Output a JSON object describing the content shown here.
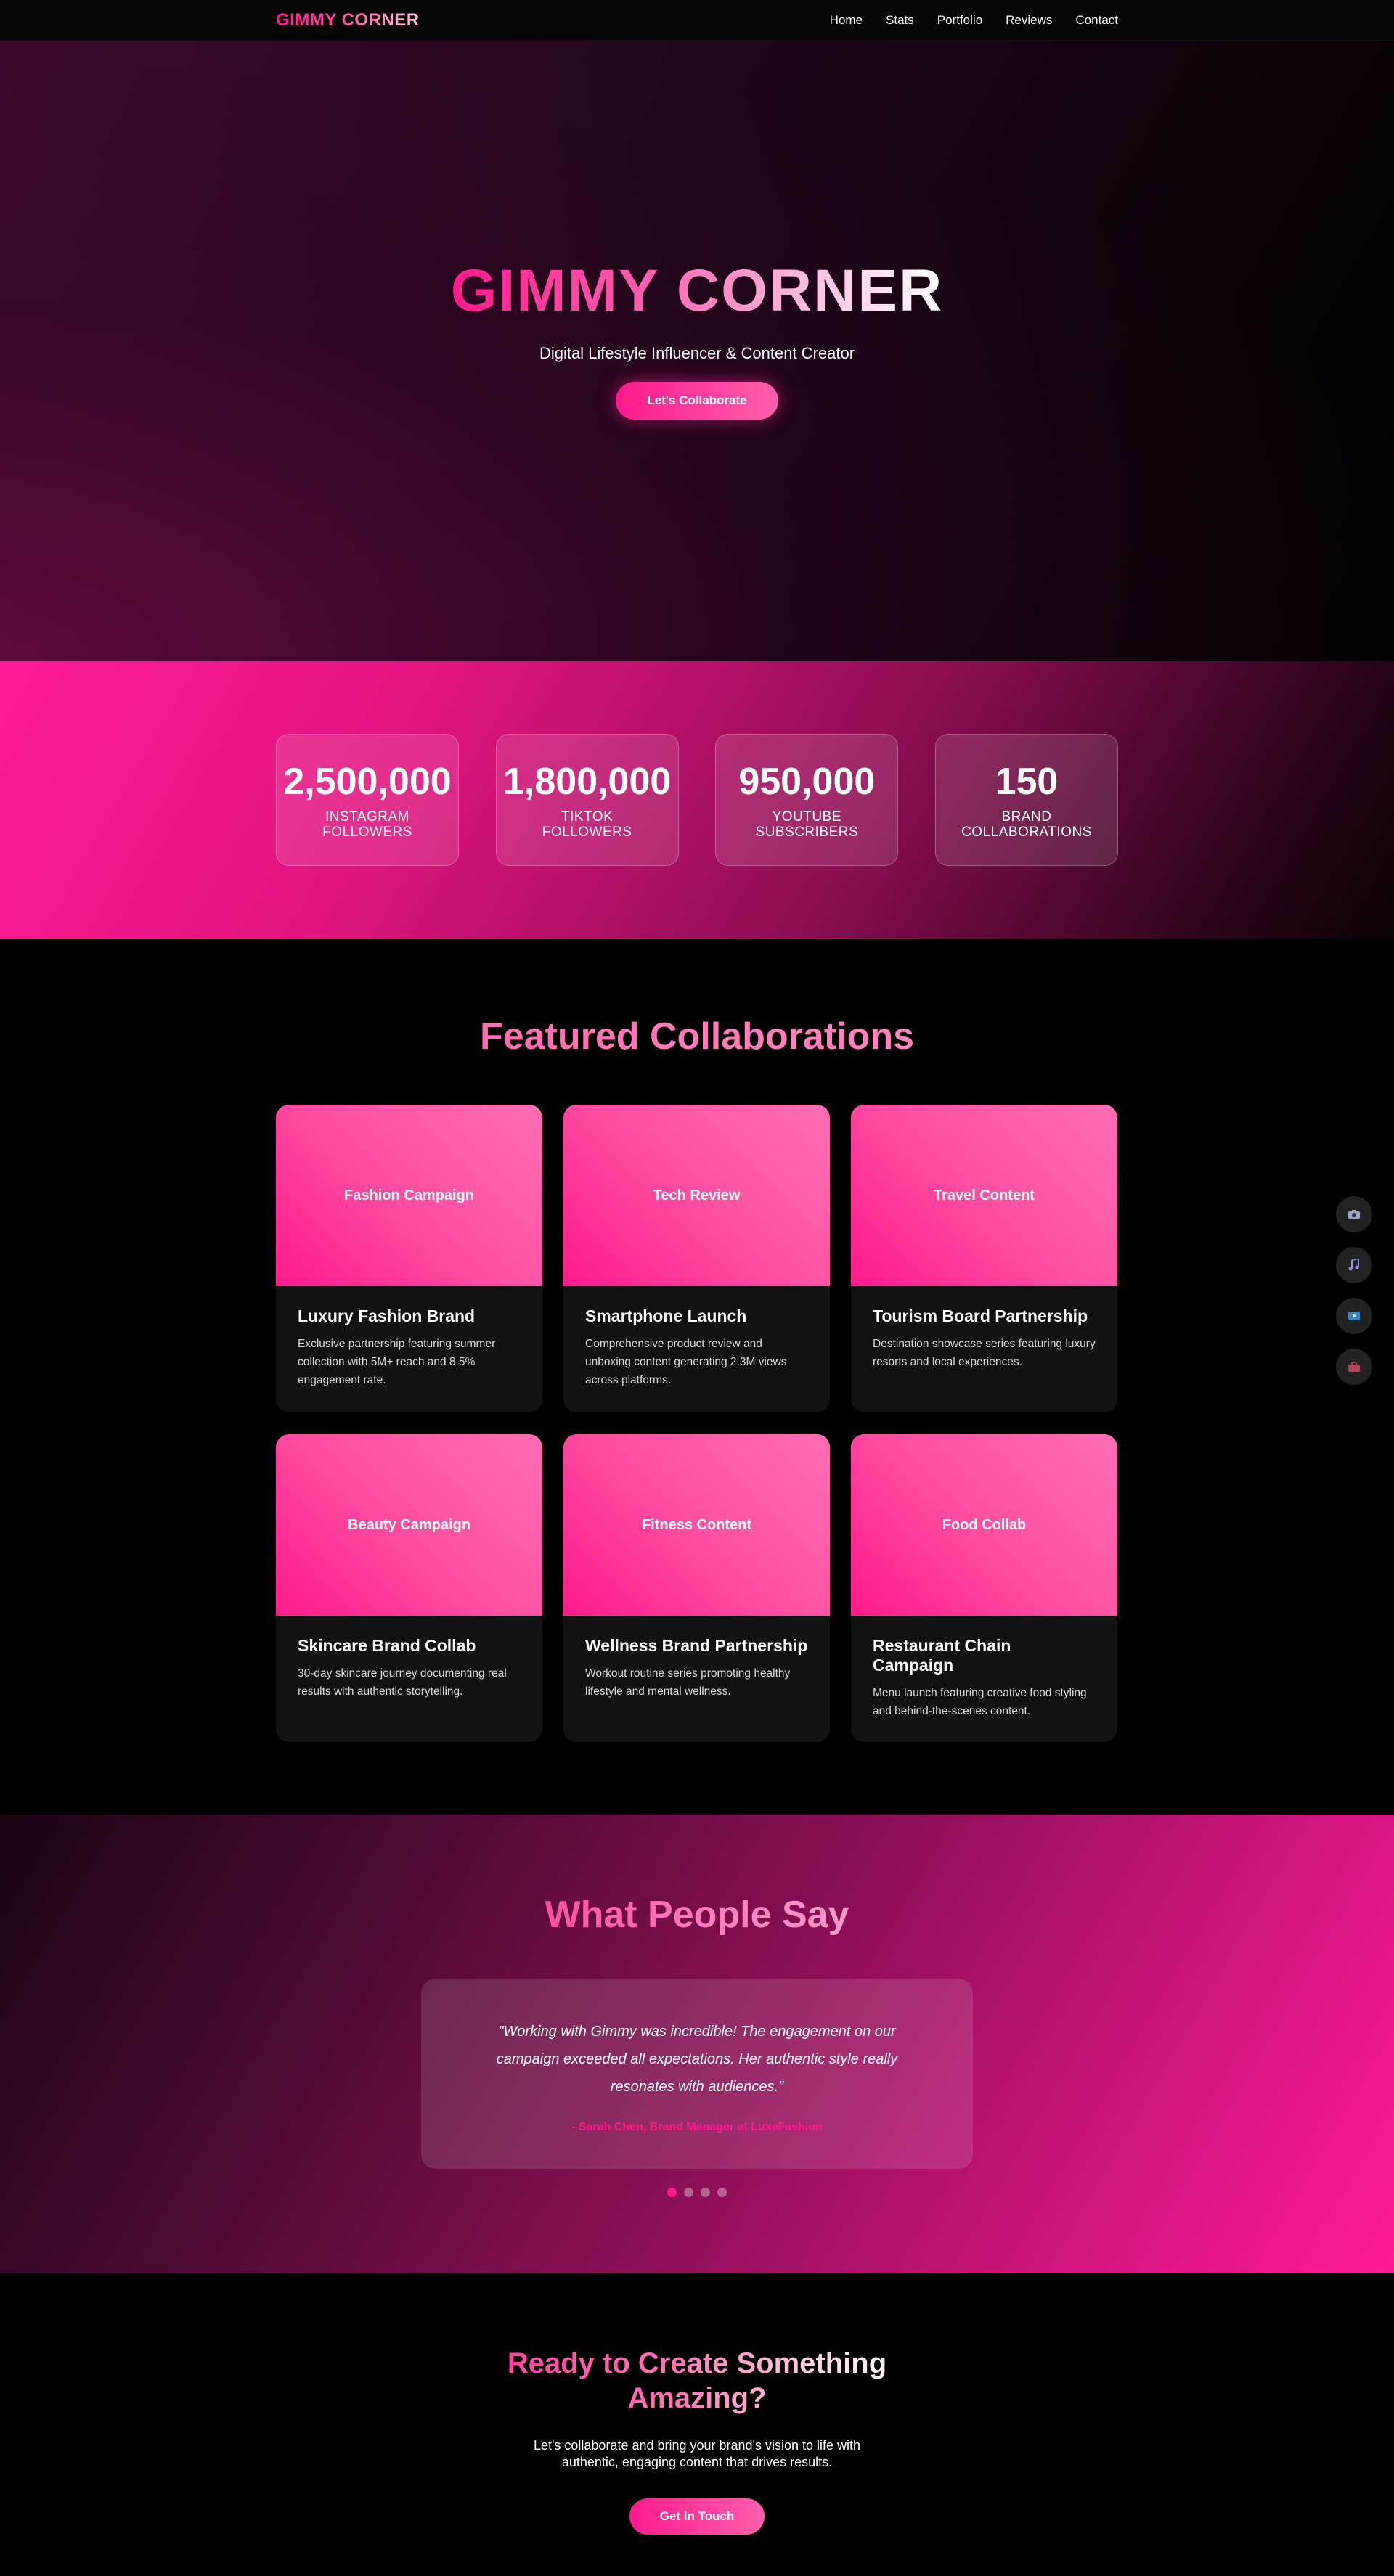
{
  "nav": {
    "logo": "GIMMY CORNER",
    "links": [
      "Home",
      "Stats",
      "Portfolio",
      "Reviews",
      "Contact"
    ]
  },
  "hero": {
    "title": "GIMMY CORNER",
    "subtitle": "Digital Lifestyle Influencer & Content Creator",
    "button": "Let's Collaborate"
  },
  "stats": [
    {
      "value": "2,500,000",
      "label_line1": "Instagram",
      "label_line2": "Followers"
    },
    {
      "value": "1,800,000",
      "label_line1": "TikTok",
      "label_line2": "Followers"
    },
    {
      "value": "950,000",
      "label_line1": "YouTube",
      "label_line2": "Subscribers"
    },
    {
      "value": "150",
      "label_line1": "Brand",
      "label_line2": "Collaborations"
    }
  ],
  "collabs": {
    "title": "Featured Collaborations",
    "cards": [
      {
        "image_label": "Fashion Campaign",
        "title": "Luxury Fashion Brand",
        "desc": "Exclusive partnership featuring summer collection with 5M+ reach and 8.5% engagement rate."
      },
      {
        "image_label": "Tech Review",
        "title": "Smartphone Launch",
        "desc": "Comprehensive product review and unboxing content generating 2.3M views across platforms."
      },
      {
        "image_label": "Travel Content",
        "title": "Tourism Board Partnership",
        "desc": "Destination showcase series featuring luxury resorts and local experiences."
      },
      {
        "image_label": "Beauty Campaign",
        "title": "Skincare Brand Collab",
        "desc": "30-day skincare journey documenting real results with authentic storytelling."
      },
      {
        "image_label": "Fitness Content",
        "title": "Wellness Brand Partnership",
        "desc": "Workout routine series promoting healthy lifestyle and mental wellness."
      },
      {
        "image_label": "Food Collab",
        "title": "Restaurant Chain Campaign",
        "desc": "Menu launch featuring creative food styling and behind-the-scenes content."
      }
    ]
  },
  "side_icons": [
    "camera-icon",
    "music-icon",
    "video-icon",
    "briefcase-icon"
  ],
  "reviews": {
    "title": "What People Say",
    "quote": "\"Working with Gimmy was incredible! The engagement on our campaign exceeded all expectations. Her authentic style really resonates with audiences.\"",
    "author": "- Sarah Chen, Brand Manager at LuxeFashion",
    "dots_count": 4,
    "active_dot": 1
  },
  "cta": {
    "title": "Ready to Create Something Amazing?",
    "text": "Let's collaborate and bring your brand's vision to life with authentic, engaging content that drives results.",
    "button": "Get In Touch"
  },
  "colors": {
    "accent": "#ff1a8c",
    "accent_light": "#ff5fae",
    "card_bg": "#121212"
  }
}
